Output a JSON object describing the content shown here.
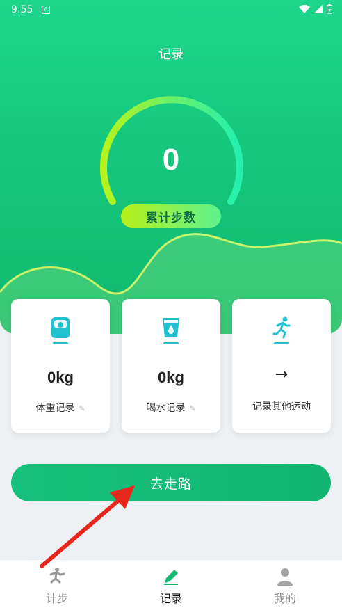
{
  "status_bar": {
    "time": "9:55",
    "notif_icon": "a-box-icon",
    "wifi_icon": "wifi-icon",
    "signal_icon": "signal-icon",
    "battery_icon": "battery-icon"
  },
  "page": {
    "title": "记录"
  },
  "steps": {
    "count": "0",
    "label": "累计步数"
  },
  "cards": [
    {
      "icon": "scale-icon",
      "value": "0kg",
      "label": "体重记录",
      "edit_icon": "pencil-icon"
    },
    {
      "icon": "water-cup-icon",
      "value": "0kg",
      "label": "喝水记录",
      "edit_icon": "pencil-icon"
    },
    {
      "icon": "running-person-icon",
      "label": "记录其他运动",
      "arrow_icon": "arrow-right-icon"
    }
  ],
  "cta": {
    "label": "去走路"
  },
  "nav": [
    {
      "label": "计步",
      "icon": "walking-icon",
      "active": false
    },
    {
      "label": "记录",
      "icon": "pencil-icon",
      "active": true
    },
    {
      "label": "我的",
      "icon": "person-icon",
      "active": false
    }
  ],
  "colors": {
    "primary": "#14c47a",
    "accent_lime": "#b8f019",
    "accent_cyan": "#20c0c7",
    "annotation_red": "#e8261c"
  }
}
